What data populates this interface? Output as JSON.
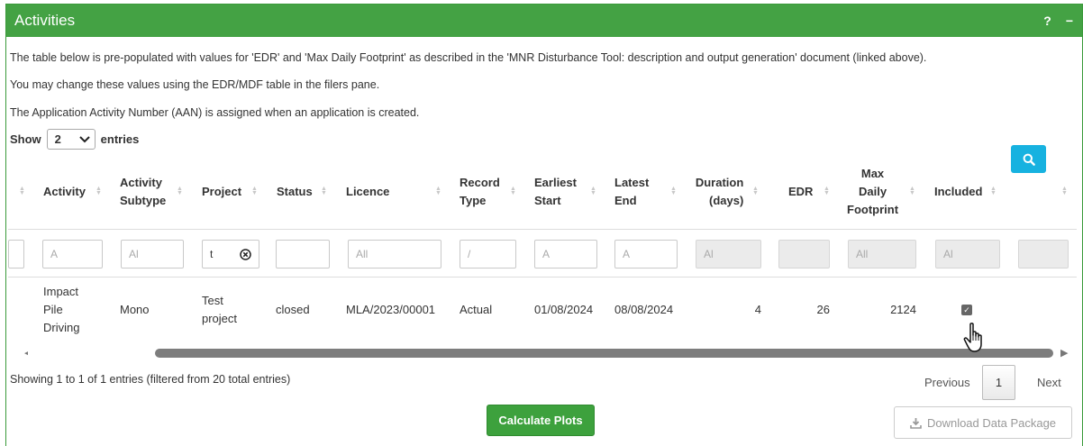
{
  "panel": {
    "title": "Activities",
    "help": "?",
    "collapse": "−"
  },
  "intro": [
    "The table below is pre-populated with values for 'EDR' and 'Max Daily Footprint' as described in the 'MNR Disturbance Tool: description and output generation' document (linked above).",
    "You may change these values using the EDR/MDF table in the filers pane.",
    "The Application Activity Number (AAN) is assigned when an application is created."
  ],
  "length": {
    "show": "Show",
    "value": "2",
    "entries": "entries"
  },
  "columns": {
    "activity": "Activity",
    "activity_subtype_1": "Activity",
    "activity_subtype_2": "Subtype",
    "project": "Project",
    "status": "Status",
    "licence": "Licence",
    "record_type_1": "Record",
    "record_type_2": "Type",
    "earliest_start_1": "Earliest",
    "earliest_start_2": "Start",
    "latest_end_1": "Latest",
    "latest_end_2": "End",
    "duration_1": "Duration",
    "duration_2": "(days)",
    "edr": "EDR",
    "max_1": "Max",
    "max_2": "Daily",
    "max_3": "Footprint",
    "included": "Included"
  },
  "filters": {
    "activity": "A",
    "subtype": "Al",
    "project": "t",
    "licence": "All",
    "record_type": "/",
    "earliest": "A",
    "latest": "A",
    "duration": "Al",
    "max": "All",
    "included": "Al"
  },
  "row": {
    "activity_1": "Impact",
    "activity_2": "Pile",
    "activity_3": "Driving",
    "subtype": "Mono",
    "project_1": "Test",
    "project_2": "project",
    "status": "closed",
    "licence": "MLA/2023/00001",
    "record_type": "Actual",
    "earliest_start": "01/08/2024",
    "latest_end": "08/08/2024",
    "duration": "4",
    "edr": "26",
    "max_daily_footprint": "2124",
    "included": true
  },
  "footer": {
    "info": "Showing 1 to 1 of 1 entries (filtered from 20 total entries)",
    "previous": "Previous",
    "page": "1",
    "next": "Next"
  },
  "buttons": {
    "calculate": "Calculate Plots",
    "download": "Download Data Package"
  },
  "colors": {
    "header": "#44a244",
    "calc": "#3da13d",
    "view": "#17b2e0"
  }
}
